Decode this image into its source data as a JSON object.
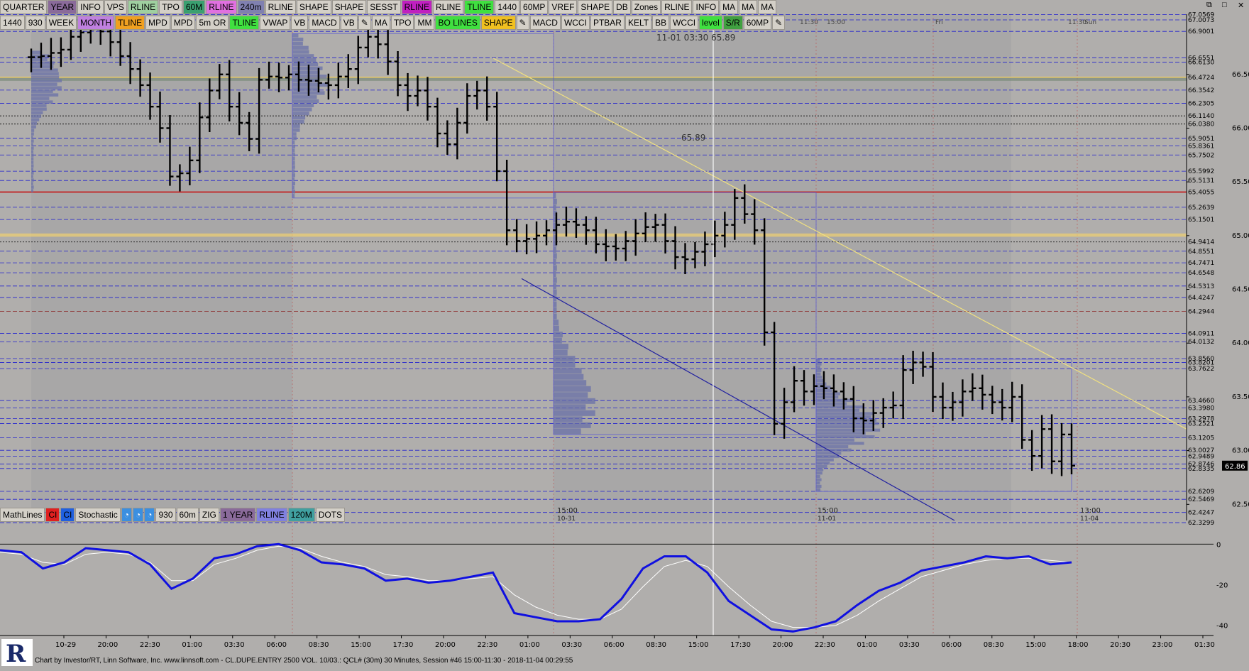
{
  "toolbar_top": [
    {
      "label": "QUARTER",
      "bg": "#d4d0c8"
    },
    {
      "label": "YEAR",
      "bg": "#8a6a9a"
    },
    {
      "label": "INFO",
      "bg": "#d4d0c8"
    },
    {
      "label": "VPS",
      "bg": "#d4d0c8"
    },
    {
      "label": "RLINE",
      "bg": "#9fd0a0"
    },
    {
      "label": "TPO",
      "bg": "#d4d0c8"
    },
    {
      "label": "60M",
      "bg": "#3aa070"
    },
    {
      "label": "RLINE",
      "bg": "#e070e0"
    },
    {
      "label": "240m",
      "bg": "#8080b0"
    },
    {
      "label": "RLINE",
      "bg": "#d4d0c8"
    },
    {
      "label": "SHAPE",
      "bg": "#d4d0c8"
    },
    {
      "label": "SHAPE",
      "bg": "#d4d0c8"
    },
    {
      "label": "SESST",
      "bg": "#d4d0c8"
    },
    {
      "label": "RLINE",
      "bg": "#c020c0"
    },
    {
      "label": "RLINE",
      "bg": "#d4d0c8"
    },
    {
      "label": "TLINE",
      "bg": "#40e040"
    },
    {
      "label": "1440",
      "bg": "#d4d0c8"
    },
    {
      "label": "60MP",
      "bg": "#d4d0c8"
    },
    {
      "label": "VREF",
      "bg": "#d4d0c8"
    },
    {
      "label": "SHAPE",
      "bg": "#d4d0c8"
    },
    {
      "label": "DB",
      "bg": "#d4d0c8"
    },
    {
      "label": "Zones",
      "bg": "#d4d0c8"
    },
    {
      "label": "RLINE",
      "bg": "#d4d0c8"
    },
    {
      "label": "INFO",
      "bg": "#d4d0c8"
    },
    {
      "label": "MA",
      "bg": "#d4d0c8"
    },
    {
      "label": "MA",
      "bg": "#d4d0c8"
    },
    {
      "label": "MA",
      "bg": "#d4d0c8"
    }
  ],
  "toolbar_second": [
    {
      "label": "1440",
      "bg": "#d4d0c8"
    },
    {
      "label": "930",
      "bg": "#d4d0c8"
    },
    {
      "label": "WEEK",
      "bg": "#d4d0c8"
    },
    {
      "label": "MONTH",
      "bg": "#c080e0"
    },
    {
      "label": "TLINE",
      "bg": "#f0a020"
    },
    {
      "label": "MPD",
      "bg": "#d4d0c8"
    },
    {
      "label": "MPD",
      "bg": "#d4d0c8"
    },
    {
      "label": "5m OR",
      "bg": "#d4d0c8"
    },
    {
      "label": "TLINE",
      "bg": "#40e040"
    },
    {
      "label": "VWAP",
      "bg": "#d4d0c8"
    },
    {
      "label": "VB",
      "bg": "#d4d0c8"
    },
    {
      "label": "MACD",
      "bg": "#d4d0c8"
    },
    {
      "label": "VB",
      "bg": "#d4d0c8"
    },
    {
      "label": "✎",
      "bg": "#d4d0c8",
      "icon": "pencil-icon"
    },
    {
      "label": "MA",
      "bg": "#d4d0c8"
    },
    {
      "label": "TPO",
      "bg": "#d4d0c8"
    },
    {
      "label": "MM",
      "bg": "#d4d0c8"
    },
    {
      "label": "BO LINES",
      "bg": "#40e040"
    },
    {
      "label": "SHAPE",
      "bg": "#f0c020"
    },
    {
      "label": "✎",
      "bg": "#d4d0c8",
      "icon": "pencil-icon"
    },
    {
      "label": "MACD",
      "bg": "#d4d0c8"
    },
    {
      "label": "WCCI",
      "bg": "#d4d0c8"
    },
    {
      "label": "PTBAR",
      "bg": "#d4d0c8"
    },
    {
      "label": "KELT",
      "bg": "#d4d0c8"
    },
    {
      "label": "BB",
      "bg": "#d4d0c8"
    },
    {
      "label": "WCCI",
      "bg": "#d4d0c8"
    },
    {
      "label": "level",
      "bg": "#40e040"
    },
    {
      "label": "S/R",
      "bg": "#40a040"
    },
    {
      "label": "60MP",
      "bg": "#d4d0c8"
    },
    {
      "label": "✎",
      "bg": "#d4d0c8",
      "icon": "pencil-icon"
    }
  ],
  "toolbar_lower": [
    {
      "label": "MathLines",
      "bg": "#d4d0c8"
    },
    {
      "label": "CI",
      "bg": "#e02020"
    },
    {
      "label": "CI",
      "bg": "#2060e0"
    },
    {
      "label": "Stochastic",
      "bg": "#d4d0c8"
    },
    {
      "label": "◔",
      "bg": "#3b8fe0",
      "icon": "clock-icon"
    },
    {
      "label": "◔",
      "bg": "#3b8fe0",
      "icon": "clock-icon"
    },
    {
      "label": "◔",
      "bg": "#3b8fe0",
      "icon": "clock-icon"
    },
    {
      "label": "930",
      "bg": "#d4d0c8"
    },
    {
      "label": "60m",
      "bg": "#d4d0c8"
    },
    {
      "label": "ZIG",
      "bg": "#d4d0c8"
    },
    {
      "label": "1 YEAR",
      "bg": "#8a6a9a"
    },
    {
      "label": "RLINE",
      "bg": "#8080e0"
    },
    {
      "label": "120M",
      "bg": "#40a0a0"
    },
    {
      "label": "DOTS",
      "bg": "#d4d0c8"
    }
  ],
  "window_controls": [
    "⧉",
    "□",
    "✕"
  ],
  "cursor_readout": "11-01 03:30  65.89",
  "crosshair_price_label": "65.89",
  "current_price": "62.86",
  "footer_text": "Chart by Investor/RT, Linn Software, Inc. www.linnsoft.com - CL.DUPE.ENTRY  2500 VOL. 10/03.: QCL# (30m) 30 Minutes, Session #46 15:00-11:30 - 2018-11-04 00:29:55",
  "top_time_labels": [
    "11:30",
    "15:00",
    "Fri",
    "11:30",
    "Sun"
  ],
  "session_marks": [
    {
      "time": "15:00",
      "date": "10-31"
    },
    {
      "time": "15:00",
      "date": "11-01"
    },
    {
      "time": "13:00",
      "date": "11-04"
    }
  ],
  "colors": {
    "background": "#b0aeac",
    "candle": "#000000",
    "profile": "#6a70a8",
    "stoch_main": "#1010e0",
    "stoch_signal": "#ffffff",
    "trendline_yellow": "#f0e080",
    "trendline_blue": "#2020a0",
    "session_band": "#a3a1a4"
  },
  "price_levels": [
    {
      "price": "67.0569",
      "color": "#2020d0",
      "style": "dash"
    },
    {
      "price": "67.0073",
      "color": "#2020d0",
      "style": "dash"
    },
    {
      "price": "66.9001",
      "color": "#2020d0",
      "style": "dash"
    },
    {
      "price": "66.6551",
      "color": "#2020d0",
      "style": "dash"
    },
    {
      "price": "66.6130",
      "color": "#2020d0",
      "style": "dash"
    },
    {
      "price": "66.4724",
      "color": "#f0d070",
      "style": "solid"
    },
    {
      "price": "66.3542",
      "color": "#2020d0",
      "style": "dash"
    },
    {
      "price": "66.2305",
      "color": "#2020d0",
      "style": "dash"
    },
    {
      "price": "66.1140",
      "color": "#000000",
      "style": "dot"
    },
    {
      "price": "66.0380",
      "color": "#000000",
      "style": "dot"
    },
    {
      "price": "65.9051",
      "color": "#2020d0",
      "style": "dash"
    },
    {
      "price": "65.8361",
      "color": "#2020d0",
      "style": "dash"
    },
    {
      "price": "65.7502",
      "color": "#2020d0",
      "style": "dash"
    },
    {
      "price": "65.5992",
      "color": "#2020d0",
      "style": "dash"
    },
    {
      "price": "65.5131",
      "color": "#2020d0",
      "style": "dash"
    },
    {
      "price": "65.4055",
      "color": "#c03030",
      "style": "solid"
    },
    {
      "price": "65.2639",
      "color": "#2020d0",
      "style": "dash"
    },
    {
      "price": "65.1501",
      "color": "#2020d0",
      "style": "dash"
    },
    {
      "price": "64.9414",
      "color": "#000000",
      "style": "dot"
    },
    {
      "price": "64.8551",
      "color": "#2020d0",
      "style": "dash"
    },
    {
      "price": "64.7471",
      "color": "#2020d0",
      "style": "dash"
    },
    {
      "price": "64.6548",
      "color": "#2020d0",
      "style": "dash"
    },
    {
      "price": "64.5313",
      "color": "#2020d0",
      "style": "dash"
    },
    {
      "price": "64.4247",
      "color": "#2020d0",
      "style": "dash"
    },
    {
      "price": "64.2944",
      "color": "#8a2020",
      "style": "dash"
    },
    {
      "price": "64.0911",
      "color": "#2020d0",
      "style": "dash"
    },
    {
      "price": "64.0132",
      "color": "#2020d0",
      "style": "dash"
    },
    {
      "price": "63.8560",
      "color": "#2020d0",
      "style": "dash"
    },
    {
      "price": "63.8201",
      "color": "#2020d0",
      "style": "dash"
    },
    {
      "price": "63.7622",
      "color": "#2020d0",
      "style": "dash"
    },
    {
      "price": "63.4660",
      "color": "#2020d0",
      "style": "dash"
    },
    {
      "price": "63.3980",
      "color": "#2020d0",
      "style": "dash"
    },
    {
      "price": "63.2978",
      "color": "#2020d0",
      "style": "dash"
    },
    {
      "price": "63.2521",
      "color": "#2020d0",
      "style": "dash"
    },
    {
      "price": "63.1205",
      "color": "#2020d0",
      "style": "dash"
    },
    {
      "price": "63.0027",
      "color": "#2020d0",
      "style": "dash"
    },
    {
      "price": "62.9489",
      "color": "#2020d0",
      "style": "dash"
    },
    {
      "price": "62.8746",
      "color": "#2020d0",
      "style": "dash"
    },
    {
      "price": "62.8335",
      "color": "#2020d0",
      "style": "dash"
    },
    {
      "price": "62.6209",
      "color": "#2020d0",
      "style": "dash"
    },
    {
      "price": "62.5469",
      "color": "#2020d0",
      "style": "dash"
    },
    {
      "price": "62.4247",
      "color": "#2020d0",
      "style": "dash"
    },
    {
      "price": "62.3299",
      "color": "#2020d0",
      "style": "dash"
    }
  ],
  "chart_data": [
    {
      "type": "ohlc",
      "title": "QCL# (30m) 30 Minutes",
      "y_axis_ticks": [
        "66.50",
        "66.00",
        "65.50",
        "65.00",
        "64.50",
        "64.00",
        "63.50",
        "63.00",
        "62.50"
      ],
      "ylim": [
        62.35,
        67.06
      ],
      "x_labels": [
        "10-29",
        "20:00",
        "22:30",
        "01:00",
        "03:30",
        "06:00",
        "08:30",
        "15:00",
        "17:30",
        "20:00",
        "22:30",
        "01:00",
        "03:30",
        "06:00",
        "08:30",
        "15:00",
        "17:30",
        "20:00",
        "22:30",
        "01:00",
        "03:30",
        "06:00",
        "08:30",
        "15:00",
        "18:00",
        "20:30",
        "23:00",
        "01:30"
      ],
      "close_path": [
        {
          "x": 0,
          "close": 66.66
        },
        {
          "x": 1,
          "close": 66.67
        },
        {
          "x": 2,
          "close": 66.7
        },
        {
          "x": 3,
          "close": 66.73
        },
        {
          "x": 4,
          "close": 66.85
        },
        {
          "x": 5,
          "close": 66.89
        },
        {
          "x": 6,
          "close": 66.92
        },
        {
          "x": 7,
          "close": 66.9
        },
        {
          "x": 8,
          "close": 66.8
        },
        {
          "x": 9,
          "close": 66.67
        },
        {
          "x": 10,
          "close": 66.55
        },
        {
          "x": 11,
          "close": 66.4
        },
        {
          "x": 12,
          "close": 66.2
        },
        {
          "x": 13,
          "close": 66.0
        },
        {
          "x": 14,
          "close": 65.55
        },
        {
          "x": 15,
          "close": 65.58
        },
        {
          "x": 16,
          "close": 65.7
        },
        {
          "x": 17,
          "close": 66.1
        },
        {
          "x": 18,
          "close": 66.35
        },
        {
          "x": 19,
          "close": 66.5
        },
        {
          "x": 20,
          "close": 66.2
        },
        {
          "x": 21,
          "close": 66.05
        },
        {
          "x": 22,
          "close": 65.9
        },
        {
          "x": 23,
          "close": 66.45
        },
        {
          "x": 24,
          "close": 66.48
        },
        {
          "x": 25,
          "close": 66.47
        },
        {
          "x": 26,
          "close": 66.5
        },
        {
          "x": 27,
          "close": 66.45
        },
        {
          "x": 28,
          "close": 66.44
        },
        {
          "x": 29,
          "close": 66.42
        },
        {
          "x": 30,
          "close": 66.4
        },
        {
          "x": 31,
          "close": 66.48
        },
        {
          "x": 32,
          "close": 66.55
        },
        {
          "x": 33,
          "close": 66.75
        },
        {
          "x": 34,
          "close": 66.85
        },
        {
          "x": 35,
          "close": 66.78
        },
        {
          "x": 36,
          "close": 66.62
        },
        {
          "x": 37,
          "close": 66.4
        },
        {
          "x": 38,
          "close": 66.3
        },
        {
          "x": 39,
          "close": 66.35
        },
        {
          "x": 40,
          "close": 66.2
        },
        {
          "x": 41,
          "close": 65.95
        },
        {
          "x": 42,
          "close": 65.85
        },
        {
          "x": 43,
          "close": 66.05
        },
        {
          "x": 44,
          "close": 66.3
        },
        {
          "x": 45,
          "close": 66.35
        },
        {
          "x": 46,
          "close": 66.2
        },
        {
          "x": 47,
          "close": 65.6
        },
        {
          "x": 48,
          "close": 65.05
        },
        {
          "x": 49,
          "close": 64.95
        },
        {
          "x": 50,
          "close": 64.97
        },
        {
          "x": 51,
          "close": 65.0
        },
        {
          "x": 52,
          "close": 65.05
        },
        {
          "x": 53,
          "close": 65.1
        },
        {
          "x": 54,
          "close": 65.13
        },
        {
          "x": 55,
          "close": 65.1
        },
        {
          "x": 56,
          "close": 65.05
        },
        {
          "x": 57,
          "close": 64.92
        },
        {
          "x": 58,
          "close": 64.9
        },
        {
          "x": 59,
          "close": 64.88
        },
        {
          "x": 60,
          "close": 64.95
        },
        {
          "x": 61,
          "close": 65.02
        },
        {
          "x": 62,
          "close": 65.08
        },
        {
          "x": 63,
          "close": 65.1
        },
        {
          "x": 64,
          "close": 64.95
        },
        {
          "x": 65,
          "close": 64.8
        },
        {
          "x": 66,
          "close": 64.78
        },
        {
          "x": 67,
          "close": 64.85
        },
        {
          "x": 68,
          "close": 64.92
        },
        {
          "x": 69,
          "close": 65.0
        },
        {
          "x": 70,
          "close": 65.1
        },
        {
          "x": 71,
          "close": 65.35
        },
        {
          "x": 72,
          "close": 65.2
        },
        {
          "x": 73,
          "close": 65.05
        },
        {
          "x": 74,
          "close": 64.1
        },
        {
          "x": 75,
          "close": 63.25
        },
        {
          "x": 76,
          "close": 63.45
        },
        {
          "x": 77,
          "close": 63.65
        },
        {
          "x": 78,
          "close": 63.55
        },
        {
          "x": 79,
          "close": 63.6
        },
        {
          "x": 80,
          "close": 63.58
        },
        {
          "x": 81,
          "close": 63.55
        },
        {
          "x": 82,
          "close": 63.48
        },
        {
          "x": 83,
          "close": 63.3
        },
        {
          "x": 84,
          "close": 63.28
        },
        {
          "x": 85,
          "close": 63.35
        },
        {
          "x": 86,
          "close": 63.4
        },
        {
          "x": 87,
          "close": 63.42
        },
        {
          "x": 88,
          "close": 63.75
        },
        {
          "x": 89,
          "close": 63.82
        },
        {
          "x": 90,
          "close": 63.78
        },
        {
          "x": 91,
          "close": 63.5
        },
        {
          "x": 92,
          "close": 63.4
        },
        {
          "x": 93,
          "close": 63.45
        },
        {
          "x": 94,
          "close": 63.55
        },
        {
          "x": 95,
          "close": 63.58
        },
        {
          "x": 96,
          "close": 63.52
        },
        {
          "x": 97,
          "close": 63.45
        },
        {
          "x": 98,
          "close": 63.4
        },
        {
          "x": 99,
          "close": 63.5
        },
        {
          "x": 100,
          "close": 63.1
        },
        {
          "x": 101,
          "close": 62.95
        },
        {
          "x": 102,
          "close": 63.2
        },
        {
          "x": 103,
          "close": 62.9
        },
        {
          "x": 104,
          "close": 63.15
        },
        {
          "x": 105,
          "close": 62.86
        }
      ],
      "annotations": [
        "65.89"
      ]
    },
    {
      "type": "line",
      "title": "Stochastic",
      "y_axis_ticks": [
        "0",
        "-20",
        "-40"
      ],
      "ylim": [
        -45,
        5
      ],
      "series": [
        {
          "name": "Stochastic",
          "values": [
            -3,
            -4,
            -12,
            -9,
            -2,
            -3,
            -4,
            -10,
            -22,
            -17,
            -7,
            -5,
            -1,
            0,
            -3,
            -9,
            -10,
            -12,
            -18,
            -17,
            -19,
            -18,
            -16,
            -14,
            -34,
            -36,
            -38,
            -38,
            -37,
            -27,
            -12,
            -6,
            -6,
            -14,
            -28,
            -35,
            -42,
            -43,
            -41,
            -38,
            -30,
            -23,
            -19,
            -13,
            -11,
            -9,
            -6,
            -7,
            -6,
            -10,
            -9
          ]
        },
        {
          "values": [
            -4,
            -5,
            -9,
            -10,
            -5,
            -4,
            -5,
            -9,
            -18,
            -18,
            -10,
            -7,
            -3,
            -1,
            -2,
            -6,
            -9,
            -11,
            -15,
            -16,
            -18,
            -18,
            -17,
            -16,
            -25,
            -31,
            -35,
            -37,
            -37,
            -32,
            -21,
            -11,
            -8,
            -11,
            -21,
            -30,
            -38,
            -41,
            -41,
            -40,
            -35,
            -28,
            -22,
            -16,
            -13,
            -10,
            -8,
            -7,
            -7,
            -8,
            -9
          ]
        }
      ]
    }
  ]
}
